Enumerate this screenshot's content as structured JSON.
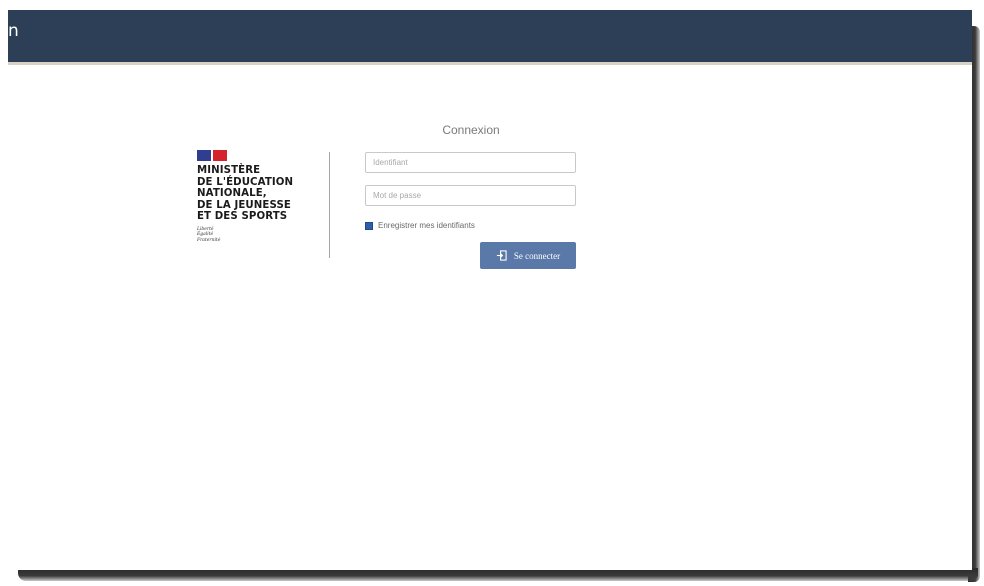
{
  "header": {
    "title": "n",
    "background_color": "#2c3f57"
  },
  "logo": {
    "lines": [
      "MINISTÈRE",
      "DE L'ÉDUCATION",
      "NATIONALE,",
      "DE LA JEUNESSE",
      "ET DES SPORTS"
    ],
    "motto": [
      "Liberté",
      "Égalité",
      "Fraternité"
    ],
    "flag_colors": [
      "#2f3e8f",
      "#d4232c"
    ]
  },
  "login": {
    "title": "Connexion",
    "username_placeholder": "Identifiant",
    "password_placeholder": "Mot de passe",
    "remember_label": "Enregistrer mes identifiants",
    "remember_checked": true,
    "submit_label": "Se connecter",
    "submit_icon": "sign-in-icon",
    "button_color": "#5a78a8"
  }
}
